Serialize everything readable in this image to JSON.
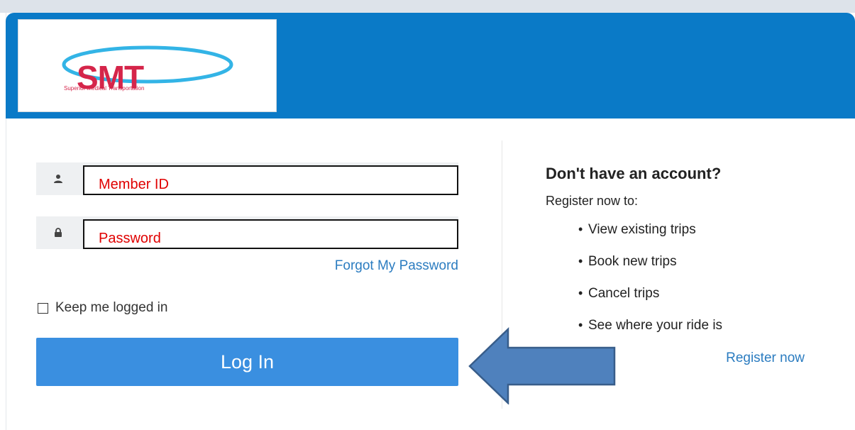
{
  "brand": {
    "logo_text": "SMT",
    "logo_subtext": "Superior Medical Transportation"
  },
  "login": {
    "member_id_placeholder": "Member ID",
    "password_placeholder": "Password",
    "forgot_link": "Forgot My Password",
    "keep_logged_in_label": "Keep me logged in",
    "keep_logged_in_checked": false,
    "login_button": "Log In"
  },
  "register": {
    "title": "Don't have an account?",
    "subtitle": "Register now to:",
    "benefits": [
      "View existing trips",
      "Book new trips",
      "Cancel trips",
      "See where your ride is"
    ],
    "link": "Register now"
  },
  "colors": {
    "header_blue": "#0a7ac7",
    "button_blue": "#3a8fe0",
    "link_blue": "#2b7cc0",
    "annotation_red": "#e00000",
    "arrow_fill": "#4f81bd",
    "arrow_stroke": "#385d8a"
  },
  "icons": {
    "member": "user-icon",
    "password": "lock-icon"
  }
}
